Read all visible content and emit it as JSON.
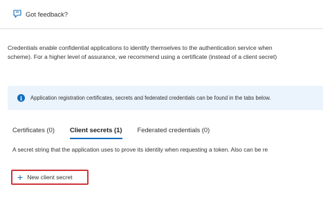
{
  "feedback": {
    "label": "Got feedback?",
    "icon": "feedback-icon"
  },
  "intro": {
    "line1": "Credentials enable confidential applications to identify themselves to the authentication service when",
    "line2": "scheme). For a higher level of assurance, we recommend using a certificate (instead of a client secret)"
  },
  "info_bar": {
    "icon": "info-icon",
    "text": "Application registration certificates, secrets and federated credentials can be found in the tabs below."
  },
  "tabs": [
    {
      "label": "Certificates (0)",
      "active": false
    },
    {
      "label": "Client secrets (1)",
      "active": true
    },
    {
      "label": "Federated credentials (0)",
      "active": false
    }
  ],
  "description": "A secret string that the application uses to prove its identity when requesting a token. Also can be re",
  "new_secret_button": {
    "icon": "plus-icon",
    "label": "New client secret"
  },
  "colors": {
    "accent": "#0f6cbd",
    "highlight_border": "#d13438",
    "info_bg": "#ebf3fc"
  }
}
